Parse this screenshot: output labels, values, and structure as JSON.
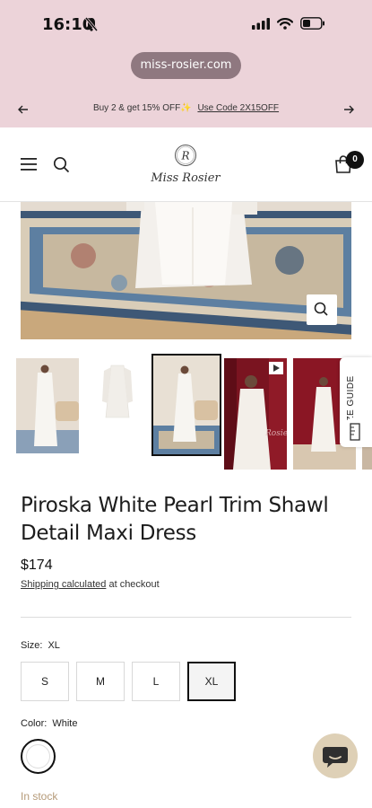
{
  "status_bar": {
    "time": "16:10"
  },
  "browser": {
    "url": "miss-rosier.com"
  },
  "announcement": {
    "text": "Buy 2 & get 15% OFF",
    "sparkle": "✨",
    "code": "Use Code 2X15OFF"
  },
  "header": {
    "logo_monogram": "R",
    "logo_text": "Miss Rosier",
    "cart_count": "0"
  },
  "gallery": {
    "thumbnail_count": 6,
    "active_index": 2,
    "size_guide_label": "SIZE GUIDE"
  },
  "product": {
    "title": "Piroska White Pearl Trim Shawl Detail Maxi Dress",
    "price": "$174",
    "shipping_link": "Shipping calculated",
    "shipping_suffix": " at checkout"
  },
  "size_option": {
    "label": "Size:",
    "selected": "XL",
    "options": [
      "S",
      "M",
      "L",
      "XL"
    ]
  },
  "color_option": {
    "label": "Color:",
    "selected": "White"
  },
  "availability": "In stock",
  "colors": {
    "brand_pink": "#ecd3d9",
    "url_pill": "#8f7880",
    "stock": "#b59a78",
    "chat": "#ded0b6"
  }
}
